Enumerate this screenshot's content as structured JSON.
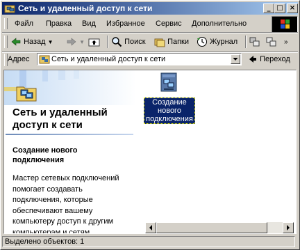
{
  "window": {
    "title": "Сеть и удаленный доступ к сети"
  },
  "menu": [
    "Файл",
    "Правка",
    "Вид",
    "Избранное",
    "Сервис",
    "Дополнительно"
  ],
  "toolbar": {
    "back": "Назад",
    "search": "Поиск",
    "folders": "Папки",
    "history": "Журнал"
  },
  "address": {
    "label": "Адрес",
    "value": "Сеть и удаленный доступ к сети",
    "go": "Переход"
  },
  "left_panel": {
    "title_line1": "Сеть и удаленный",
    "title_line2": "доступ к сети",
    "task_title_line1": "Создание нового",
    "task_title_line2": "подключения",
    "desc_lines": [
      "Мастер сетевых подключений",
      "помогает создавать",
      "подключения, которые",
      "обеспечивают вашему",
      "компьютеру доступ к другим",
      "компьютерам и сетям."
    ]
  },
  "items": [
    {
      "label_lines": [
        "Создание",
        "нового",
        "подключения"
      ]
    }
  ],
  "status": {
    "text": "Выделено объектов: 1"
  }
}
